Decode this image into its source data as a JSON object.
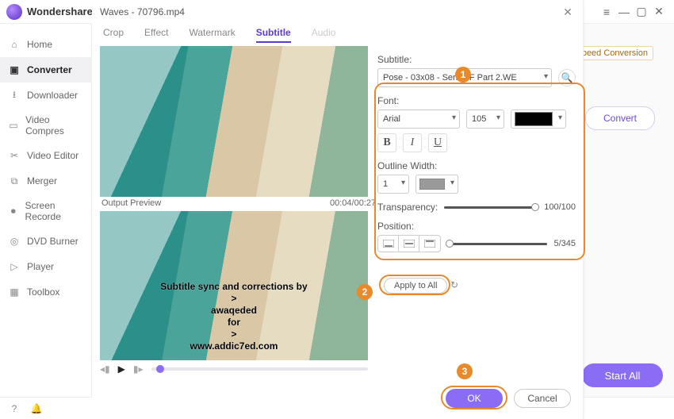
{
  "app": {
    "brand": "Wondershare"
  },
  "window": {
    "title": "Waves - 70796.mp4"
  },
  "sidebar": {
    "items": [
      {
        "label": "Home"
      },
      {
        "label": "Converter"
      },
      {
        "label": "Downloader"
      },
      {
        "label": "Video Compres"
      },
      {
        "label": "Video Editor"
      },
      {
        "label": "Merger"
      },
      {
        "label": "Screen Recorde"
      },
      {
        "label": "DVD Burner"
      },
      {
        "label": "Player"
      },
      {
        "label": "Toolbox"
      }
    ]
  },
  "background": {
    "chip": "Speed Conversion",
    "convert": "Convert",
    "start_all": "Start All"
  },
  "modal": {
    "tabs": {
      "crop": "Crop",
      "effect": "Effect",
      "watermark": "Watermark",
      "subtitle": "Subtitle",
      "audio": "Audio"
    },
    "preview": {
      "label": "Output Preview",
      "time": "00:04/00:27"
    },
    "subtitle_text": "Subtitle sync and corrections by\n>\nawaqeded\nfor\n>\nwww.addic7ed.com",
    "panel": {
      "subtitle_label": "Subtitle:",
      "subtitle_value": "Pose - 03x08 - Series F        Part 2.WE",
      "font_label": "Font:",
      "font_family": "Arial",
      "font_size": "105",
      "font_color": "#000000",
      "outline_label": "Outline Width:",
      "outline_width": "1",
      "outline_color": "#9a9a9a",
      "transparency_label": "Transparency:",
      "transparency_value": "100/100",
      "position_label": "Position:",
      "position_value": "5/345",
      "apply_all": "Apply to All",
      "ok": "OK",
      "cancel": "Cancel"
    }
  }
}
